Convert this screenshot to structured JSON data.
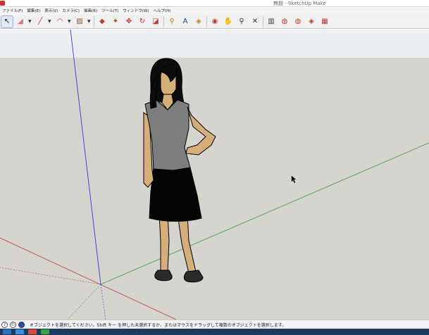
{
  "window": {
    "title": "無題 - SketchUp Make"
  },
  "menu": {
    "items": [
      "ファイル(F)",
      "編集(E)",
      "表示(V)",
      "カメラ(C)",
      "描画(R)",
      "ツール(T)",
      "ウィンドウ(W)",
      "ヘルプ(H)"
    ]
  },
  "toolbar": {
    "tools": [
      {
        "name": "select-tool",
        "glyph": "↖",
        "color": "#111111"
      },
      {
        "name": "eraser-tool",
        "glyph": "◢",
        "color": "#e06a8a"
      },
      {
        "name": "line-tool",
        "glyph": "╱",
        "color": "#c0392b"
      },
      {
        "name": "arc-tool",
        "glyph": "◠",
        "color": "#c0392b"
      },
      {
        "name": "rectangle-tool",
        "glyph": "▨",
        "color": "#8b5a3c"
      },
      {
        "name": "push-pull-tool",
        "glyph": "◆",
        "color": "#c0392b"
      },
      {
        "name": "follow-me-tool",
        "glyph": "✦",
        "color": "#c0392b"
      },
      {
        "name": "move-tool",
        "glyph": "✥",
        "color": "#d0252b"
      },
      {
        "name": "rotate-tool",
        "glyph": "↻",
        "color": "#d0252b"
      },
      {
        "name": "scale-tool",
        "glyph": "◪",
        "color": "#c0392b"
      },
      {
        "name": "tape-measure-tool",
        "glyph": "⚲",
        "color": "#b8860b"
      },
      {
        "name": "text-tool",
        "glyph": "A",
        "color": "#1f3f8f"
      },
      {
        "name": "paint-bucket-tool",
        "glyph": "◈",
        "color": "#b8860b"
      },
      {
        "name": "orbit-tool",
        "glyph": "◉",
        "color": "#c0392b"
      },
      {
        "name": "pan-tool",
        "glyph": "✋",
        "color": "#444444"
      },
      {
        "name": "zoom-tool",
        "glyph": "⚲",
        "color": "#333333"
      },
      {
        "name": "zoom-extents-tool",
        "glyph": "✕",
        "color": "#333333"
      },
      {
        "name": "warehouse-tool",
        "glyph": "▥",
        "color": "#3a3a3a"
      },
      {
        "name": "share-model-tool",
        "glyph": "◍",
        "color": "#c0392b"
      },
      {
        "name": "get-models-tool",
        "glyph": "◍",
        "color": "#c0392b"
      },
      {
        "name": "extension-warehouse-tool",
        "glyph": "◈",
        "color": "#c0392b"
      },
      {
        "name": "layout-tool",
        "glyph": "▦",
        "color": "#c0392b"
      }
    ]
  },
  "status": {
    "text": "オブジェクトを選択してください。Shift キー を押した未選択するか、またはマウスをドラッグして複数のオブジェクトを選択します。"
  },
  "colors": {
    "axis_red": "#c44040",
    "axis_green": "#3e9d3e",
    "axis_blue": "#3a3ad0",
    "ground": "#d5d4cf",
    "sky": "#eceef0"
  }
}
